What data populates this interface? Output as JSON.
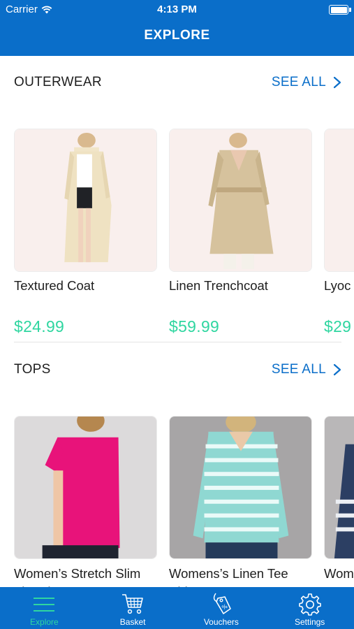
{
  "status_bar": {
    "carrier": "Carrier",
    "time": "4:13 PM"
  },
  "nav": {
    "title": "EXPLORE"
  },
  "sections": [
    {
      "title": "OUTERWEAR",
      "see_all": "SEE ALL",
      "products": [
        {
          "name": "Textured Coat",
          "price": "$24.99"
        },
        {
          "name": "Linen Trenchcoat",
          "price": "$59.99"
        },
        {
          "name": "Lyoc",
          "price": "$29"
        }
      ]
    },
    {
      "title": "TOPS",
      "see_all": "SEE ALL",
      "products": [
        {
          "name": "Women’s Stretch Slim Fit Polo"
        },
        {
          "name": "Womens’s Linen Tee Shirt"
        },
        {
          "name": "Wom neck"
        }
      ]
    }
  ],
  "tabbar": {
    "active": "Explore",
    "items": [
      {
        "label": "Explore",
        "icon": "explore-icon"
      },
      {
        "label": "Basket",
        "icon": "basket-icon"
      },
      {
        "label": "Vouchers",
        "icon": "vouchers-icon"
      },
      {
        "label": "Settings",
        "icon": "settings-icon"
      }
    ]
  },
  "colors": {
    "primary": "#0a6ec9",
    "price": "#2fd6a0",
    "active_tab": "#2fd6a0"
  }
}
